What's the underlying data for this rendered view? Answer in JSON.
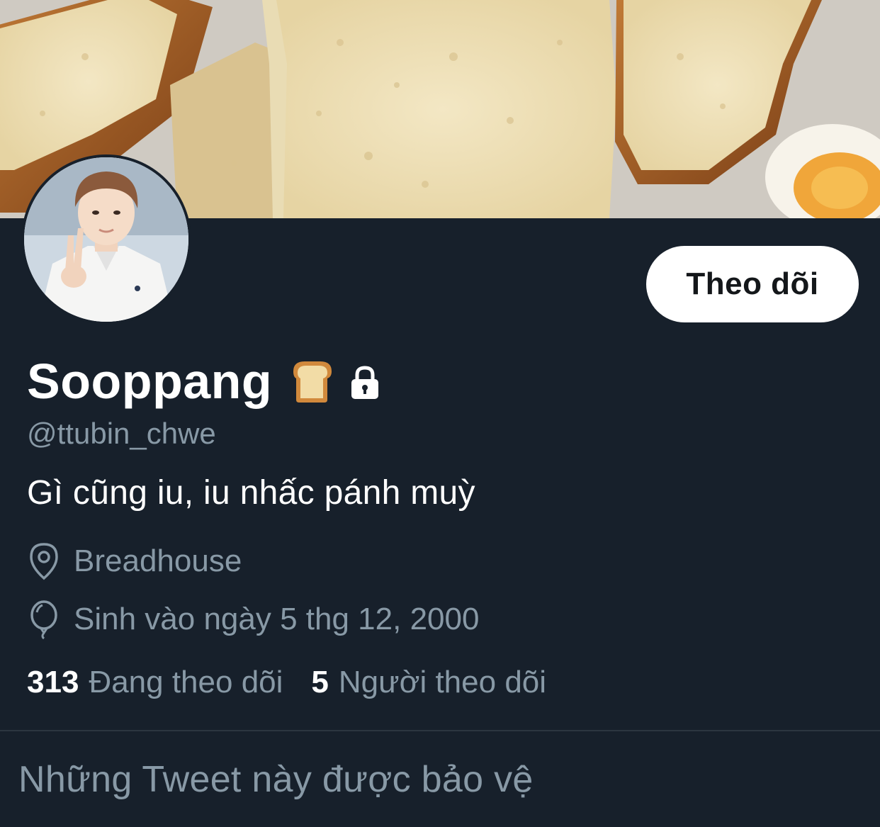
{
  "profile": {
    "display_name": "Sooppang",
    "name_emoji": "bread-icon",
    "protected_icon": "lock-icon",
    "handle": "@ttubin_chwe",
    "bio": "Gì cũng iu, iu nhấc pánh muỳ",
    "location": "Breadhouse",
    "location_icon": "location-pin-icon",
    "birthday": "Sinh vào ngày 5 thg 12, 2000",
    "birthday_icon": "balloon-icon"
  },
  "actions": {
    "follow_label": "Theo dõi"
  },
  "stats": {
    "following_count": "313",
    "following_label": "Đang theo dõi",
    "followers_count": "5",
    "followers_label": "Người theo dõi"
  },
  "feed": {
    "protected_message": "Những Tweet này được bảo vệ"
  },
  "colors": {
    "background": "#17202b",
    "secondary_text": "#8899a6",
    "primary_text": "#ffffff",
    "button_bg": "#ffffff"
  }
}
